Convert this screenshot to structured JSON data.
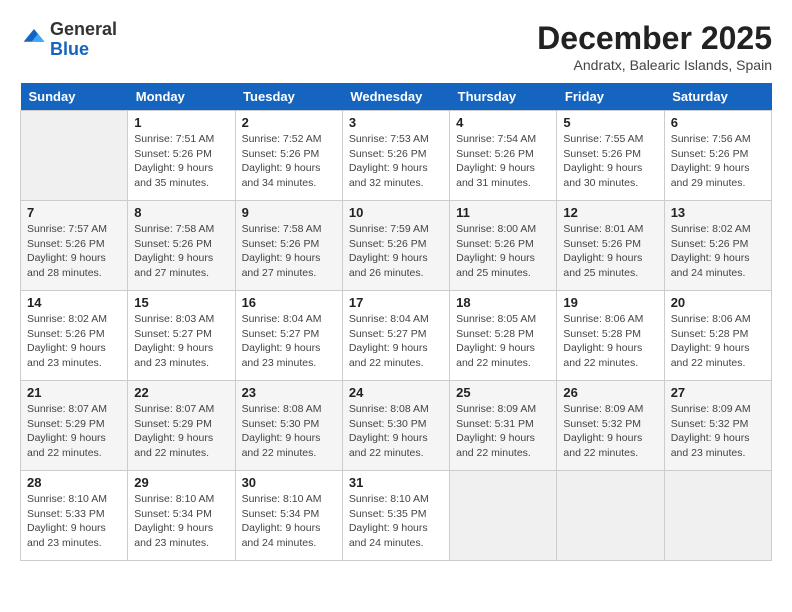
{
  "logo": {
    "general": "General",
    "blue": "Blue"
  },
  "header": {
    "month": "December 2025",
    "location": "Andratx, Balearic Islands, Spain"
  },
  "weekdays": [
    "Sunday",
    "Monday",
    "Tuesday",
    "Wednesday",
    "Thursday",
    "Friday",
    "Saturday"
  ],
  "weeks": [
    [
      {
        "day": "",
        "sunrise": "",
        "sunset": "",
        "daylight": "",
        "empty": true
      },
      {
        "day": "1",
        "sunrise": "Sunrise: 7:51 AM",
        "sunset": "Sunset: 5:26 PM",
        "daylight": "Daylight: 9 hours and 35 minutes."
      },
      {
        "day": "2",
        "sunrise": "Sunrise: 7:52 AM",
        "sunset": "Sunset: 5:26 PM",
        "daylight": "Daylight: 9 hours and 34 minutes."
      },
      {
        "day": "3",
        "sunrise": "Sunrise: 7:53 AM",
        "sunset": "Sunset: 5:26 PM",
        "daylight": "Daylight: 9 hours and 32 minutes."
      },
      {
        "day": "4",
        "sunrise": "Sunrise: 7:54 AM",
        "sunset": "Sunset: 5:26 PM",
        "daylight": "Daylight: 9 hours and 31 minutes."
      },
      {
        "day": "5",
        "sunrise": "Sunrise: 7:55 AM",
        "sunset": "Sunset: 5:26 PM",
        "daylight": "Daylight: 9 hours and 30 minutes."
      },
      {
        "day": "6",
        "sunrise": "Sunrise: 7:56 AM",
        "sunset": "Sunset: 5:26 PM",
        "daylight": "Daylight: 9 hours and 29 minutes."
      }
    ],
    [
      {
        "day": "7",
        "sunrise": "Sunrise: 7:57 AM",
        "sunset": "Sunset: 5:26 PM",
        "daylight": "Daylight: 9 hours and 28 minutes."
      },
      {
        "day": "8",
        "sunrise": "Sunrise: 7:58 AM",
        "sunset": "Sunset: 5:26 PM",
        "daylight": "Daylight: 9 hours and 27 minutes."
      },
      {
        "day": "9",
        "sunrise": "Sunrise: 7:58 AM",
        "sunset": "Sunset: 5:26 PM",
        "daylight": "Daylight: 9 hours and 27 minutes."
      },
      {
        "day": "10",
        "sunrise": "Sunrise: 7:59 AM",
        "sunset": "Sunset: 5:26 PM",
        "daylight": "Daylight: 9 hours and 26 minutes."
      },
      {
        "day": "11",
        "sunrise": "Sunrise: 8:00 AM",
        "sunset": "Sunset: 5:26 PM",
        "daylight": "Daylight: 9 hours and 25 minutes."
      },
      {
        "day": "12",
        "sunrise": "Sunrise: 8:01 AM",
        "sunset": "Sunset: 5:26 PM",
        "daylight": "Daylight: 9 hours and 25 minutes."
      },
      {
        "day": "13",
        "sunrise": "Sunrise: 8:02 AM",
        "sunset": "Sunset: 5:26 PM",
        "daylight": "Daylight: 9 hours and 24 minutes."
      }
    ],
    [
      {
        "day": "14",
        "sunrise": "Sunrise: 8:02 AM",
        "sunset": "Sunset: 5:26 PM",
        "daylight": "Daylight: 9 hours and 23 minutes."
      },
      {
        "day": "15",
        "sunrise": "Sunrise: 8:03 AM",
        "sunset": "Sunset: 5:27 PM",
        "daylight": "Daylight: 9 hours and 23 minutes."
      },
      {
        "day": "16",
        "sunrise": "Sunrise: 8:04 AM",
        "sunset": "Sunset: 5:27 PM",
        "daylight": "Daylight: 9 hours and 23 minutes."
      },
      {
        "day": "17",
        "sunrise": "Sunrise: 8:04 AM",
        "sunset": "Sunset: 5:27 PM",
        "daylight": "Daylight: 9 hours and 22 minutes."
      },
      {
        "day": "18",
        "sunrise": "Sunrise: 8:05 AM",
        "sunset": "Sunset: 5:28 PM",
        "daylight": "Daylight: 9 hours and 22 minutes."
      },
      {
        "day": "19",
        "sunrise": "Sunrise: 8:06 AM",
        "sunset": "Sunset: 5:28 PM",
        "daylight": "Daylight: 9 hours and 22 minutes."
      },
      {
        "day": "20",
        "sunrise": "Sunrise: 8:06 AM",
        "sunset": "Sunset: 5:28 PM",
        "daylight": "Daylight: 9 hours and 22 minutes."
      }
    ],
    [
      {
        "day": "21",
        "sunrise": "Sunrise: 8:07 AM",
        "sunset": "Sunset: 5:29 PM",
        "daylight": "Daylight: 9 hours and 22 minutes."
      },
      {
        "day": "22",
        "sunrise": "Sunrise: 8:07 AM",
        "sunset": "Sunset: 5:29 PM",
        "daylight": "Daylight: 9 hours and 22 minutes."
      },
      {
        "day": "23",
        "sunrise": "Sunrise: 8:08 AM",
        "sunset": "Sunset: 5:30 PM",
        "daylight": "Daylight: 9 hours and 22 minutes."
      },
      {
        "day": "24",
        "sunrise": "Sunrise: 8:08 AM",
        "sunset": "Sunset: 5:30 PM",
        "daylight": "Daylight: 9 hours and 22 minutes."
      },
      {
        "day": "25",
        "sunrise": "Sunrise: 8:09 AM",
        "sunset": "Sunset: 5:31 PM",
        "daylight": "Daylight: 9 hours and 22 minutes."
      },
      {
        "day": "26",
        "sunrise": "Sunrise: 8:09 AM",
        "sunset": "Sunset: 5:32 PM",
        "daylight": "Daylight: 9 hours and 22 minutes."
      },
      {
        "day": "27",
        "sunrise": "Sunrise: 8:09 AM",
        "sunset": "Sunset: 5:32 PM",
        "daylight": "Daylight: 9 hours and 23 minutes."
      }
    ],
    [
      {
        "day": "28",
        "sunrise": "Sunrise: 8:10 AM",
        "sunset": "Sunset: 5:33 PM",
        "daylight": "Daylight: 9 hours and 23 minutes."
      },
      {
        "day": "29",
        "sunrise": "Sunrise: 8:10 AM",
        "sunset": "Sunset: 5:34 PM",
        "daylight": "Daylight: 9 hours and 23 minutes."
      },
      {
        "day": "30",
        "sunrise": "Sunrise: 8:10 AM",
        "sunset": "Sunset: 5:34 PM",
        "daylight": "Daylight: 9 hours and 24 minutes."
      },
      {
        "day": "31",
        "sunrise": "Sunrise: 8:10 AM",
        "sunset": "Sunset: 5:35 PM",
        "daylight": "Daylight: 9 hours and 24 minutes."
      },
      {
        "day": "",
        "sunrise": "",
        "sunset": "",
        "daylight": "",
        "empty": true
      },
      {
        "day": "",
        "sunrise": "",
        "sunset": "",
        "daylight": "",
        "empty": true
      },
      {
        "day": "",
        "sunrise": "",
        "sunset": "",
        "daylight": "",
        "empty": true
      }
    ]
  ]
}
